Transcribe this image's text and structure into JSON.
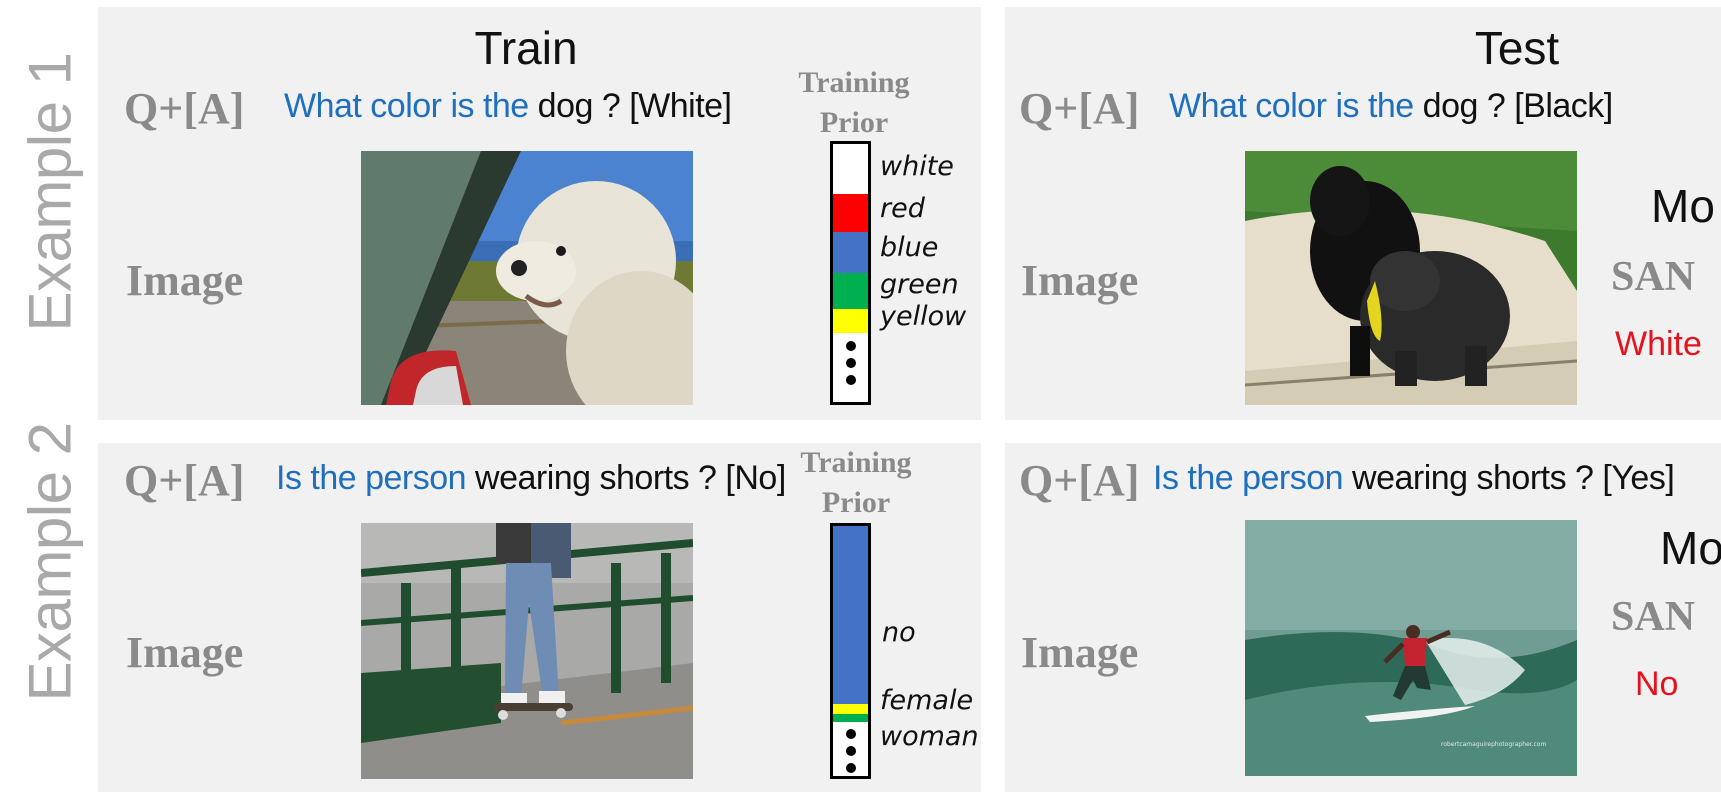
{
  "rows": [
    {
      "label": "Example 1"
    },
    {
      "label": "Example 2"
    }
  ],
  "columns": {
    "train": "Train",
    "test": "Test"
  },
  "qa_label": "Q+[A]",
  "image_label": "Image",
  "prior_title": [
    "Training",
    "Prior"
  ],
  "example1": {
    "train": {
      "question_prefix": "What color is the",
      "question_rest": " dog ? [White]",
      "prior_labels": [
        "white",
        "red",
        "blue",
        "green",
        "yellow"
      ],
      "prior_colors": [
        "#ffffff",
        "#ff0000",
        "#4472c4",
        "#00b050",
        "#ffff00"
      ],
      "image": "white-dog-in-car"
    },
    "test": {
      "question_prefix": "What color is the",
      "question_rest": " dog ? [Black]",
      "model_label": "Mo",
      "san_label": "SAN",
      "prediction": "White",
      "image": "black-dogs-on-hammock"
    }
  },
  "example2": {
    "train": {
      "question_prefix": "Is the person",
      "question_rest": " wearing shorts ? [No]",
      "prior_labels": [
        "no",
        "female",
        "woman"
      ],
      "prior_colors": [
        "#4472c4",
        "#ffff00",
        "#00b050"
      ],
      "image": "person-on-skateboard"
    },
    "test": {
      "question_prefix": "Is the person",
      "question_rest": " wearing shorts ? [Yes]",
      "model_label": "Mo",
      "san_label": "SAN",
      "prediction": "No",
      "watermark": "robertcamaguirephotographer.com",
      "image": "surfer-on-wave"
    }
  },
  "colors": {
    "question_blue": "#1f6fbe",
    "prediction_red": "#e5131d",
    "label_gray": "#8a8a8a"
  }
}
